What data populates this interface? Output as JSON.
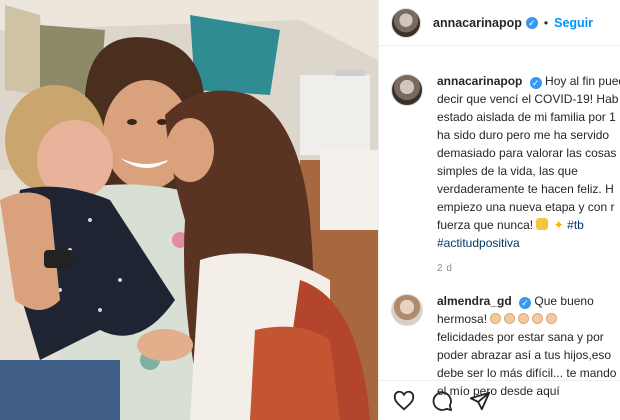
{
  "post": {
    "username": "annacarinapop",
    "verified_icon": "verified-badge-icon",
    "separator": "•",
    "follow_label": "Seguir"
  },
  "caption": {
    "username": "annacarinapop",
    "lines": [
      "Hoy al fin pued",
      "decir que vencí el COVID-19! Hab",
      "estado aislada de mi familia por 1",
      "ha sido duro pero me ha servido",
      "demasiado para valorar las cosas",
      "simples de la vida, las que",
      "verdaderamente te hacen feliz. H",
      "empiezo una nueva etapa y con r",
      "fuerza que nunca!"
    ],
    "hashtags": [
      "#tb",
      "#actitudpositiva"
    ],
    "emoji": [
      "flexed-biceps-emoji",
      "sparkles-emoji"
    ],
    "time": "2 d"
  },
  "reply": {
    "username": "almendra_gd",
    "lines": [
      "Que bueno",
      "hermosa!",
      "felicidades por estar sana y por",
      "poder abrazar así a tus hijos,eso",
      "debe ser lo más difícil... te mando",
      "el mío pero desde aquí"
    ],
    "emoji": [
      "clapping-hands-emoji"
    ]
  },
  "actions": {
    "icons": [
      "heart-icon",
      "comment-icon",
      "share-icon"
    ]
  },
  "colors": {
    "link": "#0095f6",
    "hashtag": "#00376b",
    "verified": "#3897f0",
    "text": "#262626",
    "muted": "#8e8e8e"
  }
}
